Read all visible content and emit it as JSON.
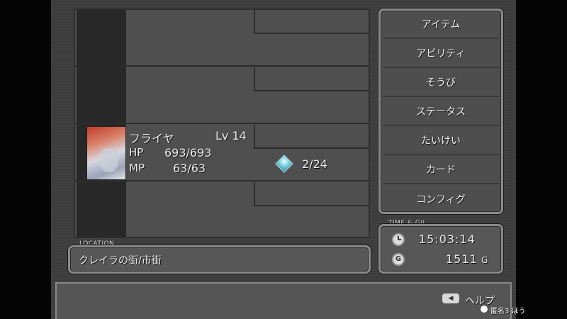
{
  "party": {
    "slot3": {
      "name": "フライヤ",
      "level": "Lv 14",
      "hp_label": "HP",
      "hp_value": "693/693",
      "mp_label": "MP",
      "mp_value": "63/63",
      "stones": "2/24"
    }
  },
  "menu": {
    "items": [
      "アイテム",
      "アビリティ",
      "そうび",
      "ステータス",
      "たいけい",
      "カード",
      "コンフィグ"
    ]
  },
  "location": {
    "tag": "LOCATION",
    "value": "クレイラの街/市街"
  },
  "time_gil": {
    "tag": "TIME & GIL",
    "time": "15:03:14",
    "gil": "1511",
    "gil_unit": "G",
    "gil_icon_letter": "G"
  },
  "help": {
    "label": "ヘルプ"
  },
  "overlay": {
    "text": "匿名3  ほう"
  },
  "icons": {
    "clock": "clock-icon",
    "gil": "gil-coin-icon",
    "crystal": "magic-stone-icon",
    "help_button": "select-button-icon"
  }
}
